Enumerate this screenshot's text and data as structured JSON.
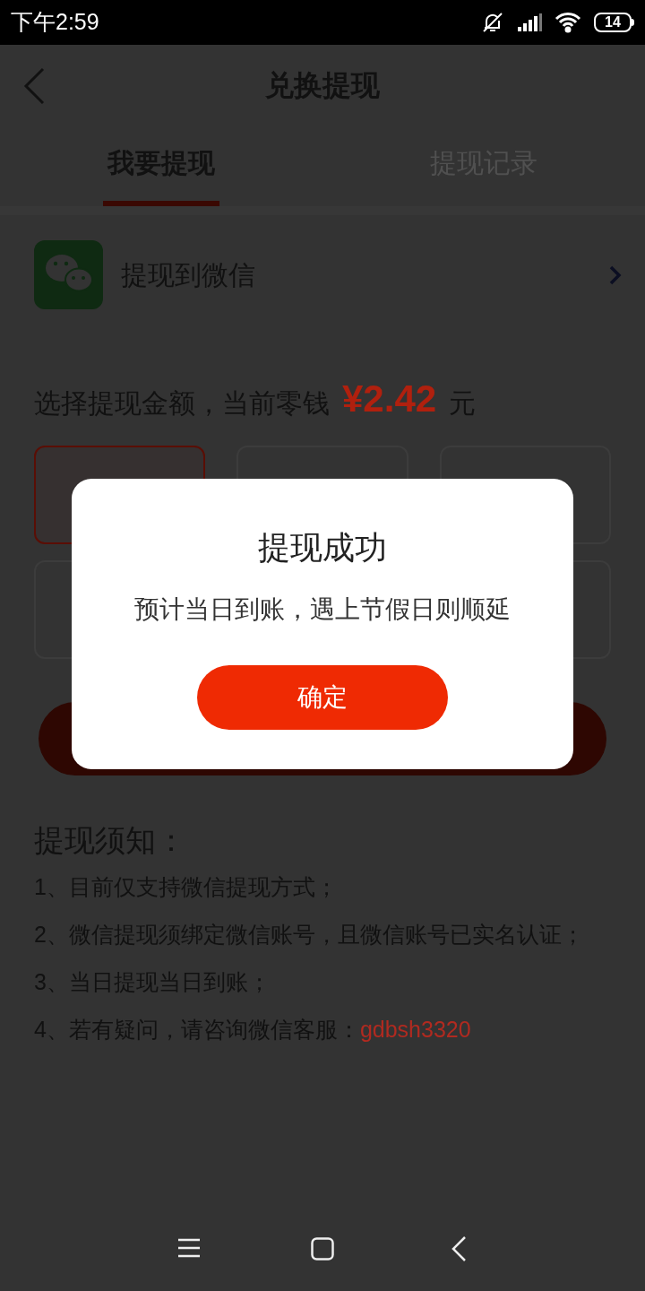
{
  "status_bar": {
    "time": "下午2:59",
    "battery": "14"
  },
  "header": {
    "title": "兑换提现"
  },
  "tabs": [
    {
      "label": "我要提现",
      "selected": true
    },
    {
      "label": "提现记录",
      "selected": false
    }
  ],
  "payout_method": {
    "label": "提现到微信"
  },
  "amount": {
    "label": "选择提现金额，当前零钱",
    "value": "¥2.42",
    "unit": "元"
  },
  "amount_options": [
    {
      "selected": true
    },
    {
      "selected": false
    },
    {
      "selected": false
    },
    {
      "selected": false
    },
    {
      "selected": false
    }
  ],
  "notes": {
    "title": "提现须知：",
    "items": [
      {
        "text": "1、目前仅支持微信提现方式；"
      },
      {
        "text": "2、微信提现须绑定微信账号，且微信账号已实名认证；"
      },
      {
        "text": "3、当日提现当日到账；"
      },
      {
        "text": "4、若有疑问，请咨询微信客服：",
        "link": "gdbsh3320"
      }
    ]
  },
  "dialog": {
    "title": "提现成功",
    "message": "预计当日到账，遇上节假日则顺延",
    "button": "确定"
  }
}
